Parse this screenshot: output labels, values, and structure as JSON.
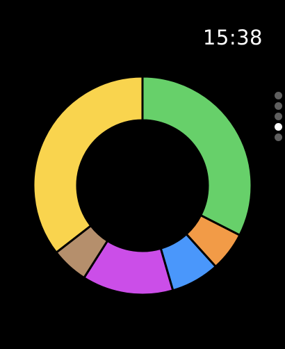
{
  "status_bar": {
    "time": "15:38"
  },
  "page_indicator": {
    "total": 5,
    "active_index": 3,
    "active_color": "#ffffff",
    "inactive_color": "#5f5f5f"
  },
  "chart_data": {
    "type": "pie",
    "style": "donut",
    "start": "top-clockwise",
    "slices": [
      {
        "value": 32.5,
        "color": "#67d06a",
        "icon": "green-segment"
      },
      {
        "value": 5.8,
        "color": "#f29b47",
        "icon": "orange-segment"
      },
      {
        "value": 7.2,
        "color": "#4a97fb",
        "icon": "blue-segment"
      },
      {
        "value": 13.5,
        "color": "#cb4ee8",
        "icon": "purple-segment"
      },
      {
        "value": 5.5,
        "color": "#b58f6c",
        "icon": "brown-segment"
      },
      {
        "value": 35.5,
        "color": "#f9d44e",
        "icon": "yellow-segment"
      }
    ],
    "background_color": "#000000",
    "separator_color": "#000000"
  }
}
